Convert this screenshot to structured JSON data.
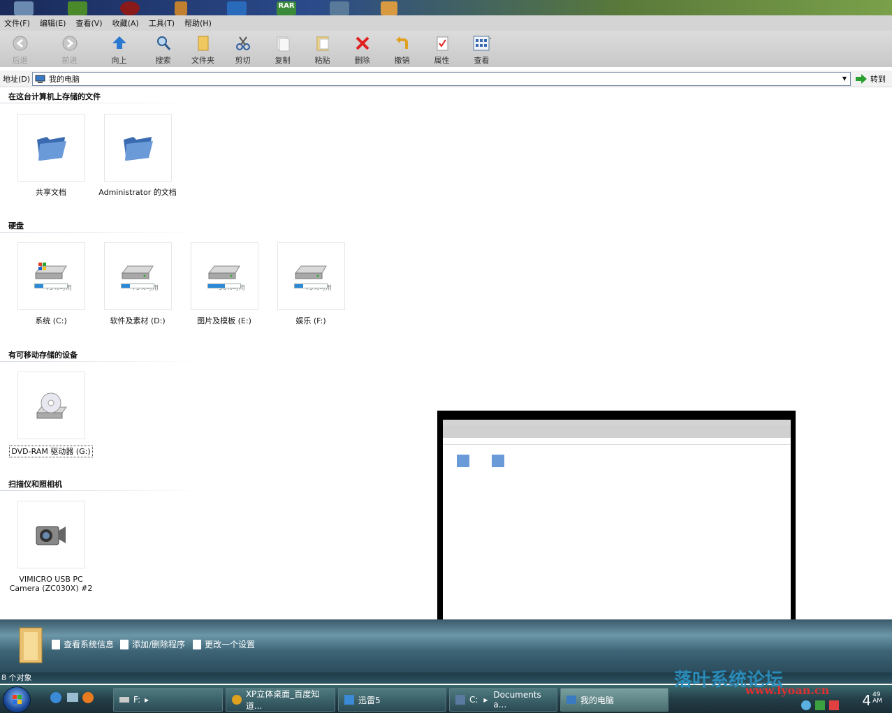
{
  "desktop_icons": [
    "app-icon",
    "tv-icon",
    "media-icon",
    "tool-icon",
    "browser-icon",
    "rar-icon",
    "folder-icon",
    "jps-icon"
  ],
  "menu": [
    {
      "label": "文件(F)"
    },
    {
      "label": "编辑(E)"
    },
    {
      "label": "查看(V)"
    },
    {
      "label": "收藏(A)"
    },
    {
      "label": "工具(T)"
    },
    {
      "label": "帮助(H)"
    }
  ],
  "toolbar": {
    "back": "后退",
    "forward": "前进",
    "up": "向上",
    "search": "搜索",
    "folders": "文件夹",
    "cut": "剪切",
    "copy": "复制",
    "paste": "粘贴",
    "delete": "删除",
    "undo": "撤销",
    "properties": "属性",
    "view": "查看"
  },
  "address": {
    "label": "地址(D)",
    "value": "我的电脑",
    "go": "转到"
  },
  "sections": {
    "stored": "在这台计算机上存储的文件",
    "harddisk": "硬盘",
    "removable": "有可移动存储的设备",
    "scanner": "扫描仪和照相机"
  },
  "folders": [
    {
      "label": "共享文档"
    },
    {
      "label": "Administrator 的文档"
    }
  ],
  "drives": [
    {
      "label": "系统 (C:)",
      "cap": "75%可用",
      "free": 0.25
    },
    {
      "label": "软件及素材 (D:)",
      "cap": "75%可用",
      "free": 0.25
    },
    {
      "label": "图片及模板 (E:)",
      "cap": "50%可用",
      "free": 0.5
    },
    {
      "label": "娱乐 (F:)",
      "cap": "75%可用",
      "free": 0.25
    }
  ],
  "dvd": {
    "label": "DVD-RAM 驱动器 (G:)"
  },
  "camera": {
    "label1": "VIMICRO USB PC",
    "label2": "Camera (ZC030X) #2"
  },
  "infobar": {
    "link1": "查看系统信息",
    "link2": "添加/删除程序",
    "link3": "更改一个设置"
  },
  "status": "8 个对象",
  "taskbar": {
    "task1": "F:",
    "task2": "XP立体桌面_百度知道...",
    "task3": "迅雷5",
    "task4a": "C:",
    "task4b": "Documents a...",
    "task5": "我的电脑",
    "clock": "4",
    "clock_sup": "49",
    "clock_ampm": "AM",
    "watermark1": "落叶系统论坛",
    "watermark2": "www.lyoan.cn"
  },
  "colors": {
    "accent": "#2a8ad8",
    "infobar": "#3d6476",
    "taskbar": "#243e48"
  }
}
